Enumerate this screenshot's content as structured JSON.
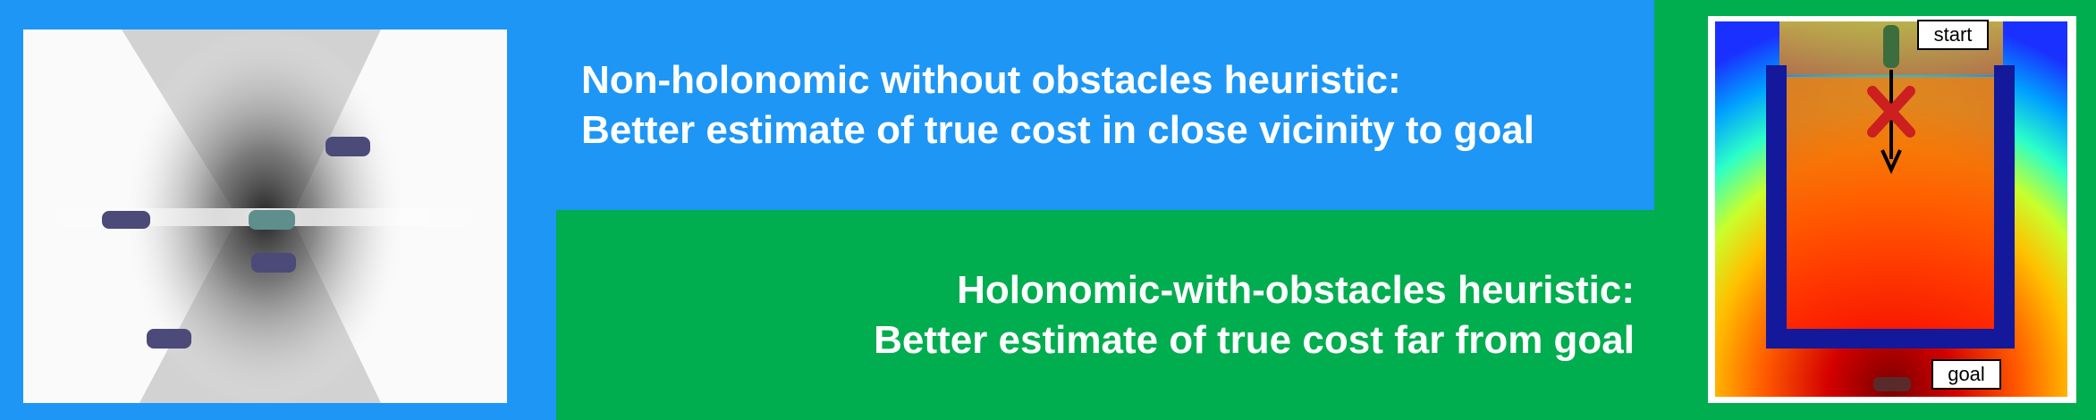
{
  "top_panel": {
    "title_line1": "Non-holonomic without obstacles heuristic:",
    "title_line2": "Better estimate of true cost in close vicinity to goal"
  },
  "bottom_panel": {
    "title_line1": "Holonomic-with-obstacles heuristic:",
    "title_line2": "Better estimate of true cost far from goal"
  },
  "right_figure": {
    "start_label": "start",
    "goal_label": "goal"
  },
  "colors": {
    "blue_background": "#1e96f5",
    "green_background": "#00ad4f",
    "wall": "#13199a",
    "cross": "#cc1f1f",
    "text": "#ffffff"
  }
}
